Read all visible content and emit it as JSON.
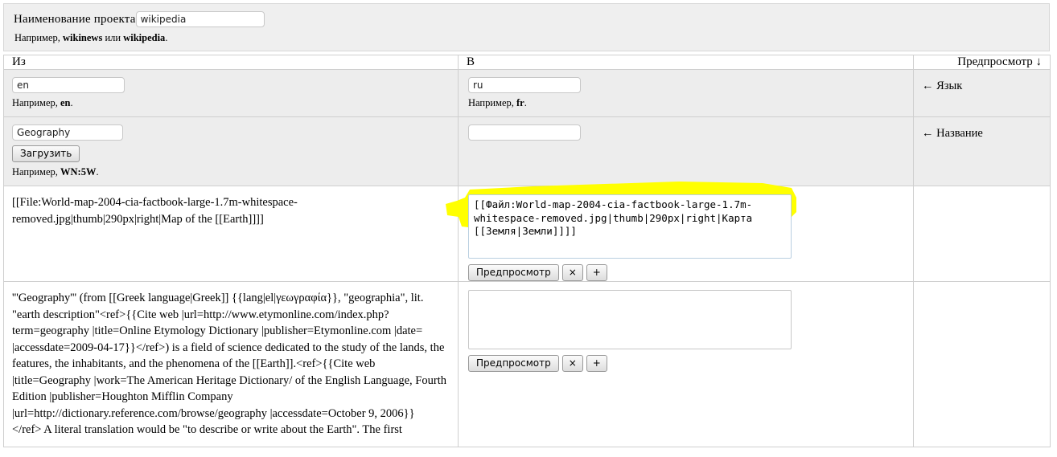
{
  "project": {
    "label": "Наименование проекта",
    "value": "wikipedia",
    "hint_prefix": "Например, ",
    "hint_a": "wikinews",
    "hint_mid": " или ",
    "hint_b": "wikipedia",
    "hint_suffix": "."
  },
  "table": {
    "headers": {
      "from": "Из",
      "to": "В",
      "preview": "Предпросмотр ↓"
    },
    "rows": [
      {
        "kind": "language",
        "from_value": "en",
        "from_hint_prefix": "Например, ",
        "from_hint_bold": "en",
        "from_hint_suffix": ".",
        "to_value": "ru",
        "to_hint_prefix": "Например, ",
        "to_hint_bold": "fr",
        "to_hint_suffix": ".",
        "preview": "← Язык"
      },
      {
        "kind": "title",
        "from_value": "Geography",
        "upload_button": "Загрузить",
        "from_hint_prefix": "Например, ",
        "from_hint_bold": "WN:5W",
        "from_hint_suffix": ".",
        "to_value": "",
        "preview": "← Название"
      },
      {
        "kind": "image-paragraph",
        "source_text": "[[File:World-map-2004-cia-factbook-large-1.7m-whitespace-removed.jpg|thumb|290px|right|Map of the [[Earth]]]]",
        "target_text": "[[Файл:World-map-2004-cia-factbook-large-1.7m-whitespace-removed.jpg|thumb|290px|right|Карта [[Земля|Земли]]]]",
        "preview_button": "Предпросмотр",
        "remove_button": "×",
        "add_button": "+",
        "highlighted": true,
        "preview": ""
      },
      {
        "kind": "text-paragraph",
        "source_text": "'''Geography''' (from [[Greek language|Greek]] {{lang|el|γεωγραφία}}, \"geographia\", lit. \"earth description\"<ref>{{Cite web |url=http://www.etymonline.com/index.php?term=geography |title=Online Etymology Dictionary |publisher=Etymonline.com |date= |accessdate=2009-04-17}}</ref>) is a field of science dedicated to the study of the lands, the features, the inhabitants, and the phenomena of the [[Earth]].<ref>{{Cite web |title=Geography |work=The American Heritage Dictionary/ of the English Language, Fourth Edition |publisher=Houghton Mifflin Company |url=http://dictionary.reference.com/browse/geography |accessdate=October 9, 2006}} </ref> A literal translation would be \"to describe or write about the Earth\". The first",
        "target_text": "",
        "preview_button": "Предпросмотр",
        "remove_button": "×",
        "add_button": "+",
        "highlighted": false,
        "preview": ""
      }
    ]
  },
  "colors": {
    "panel_bg": "#efefef",
    "row_grey": "#ededed",
    "row_white": "#ffffff",
    "border": "#cfcfcf",
    "marker_yellow": "#ffff00",
    "textarea_focus_border": "#b9cfe0"
  }
}
